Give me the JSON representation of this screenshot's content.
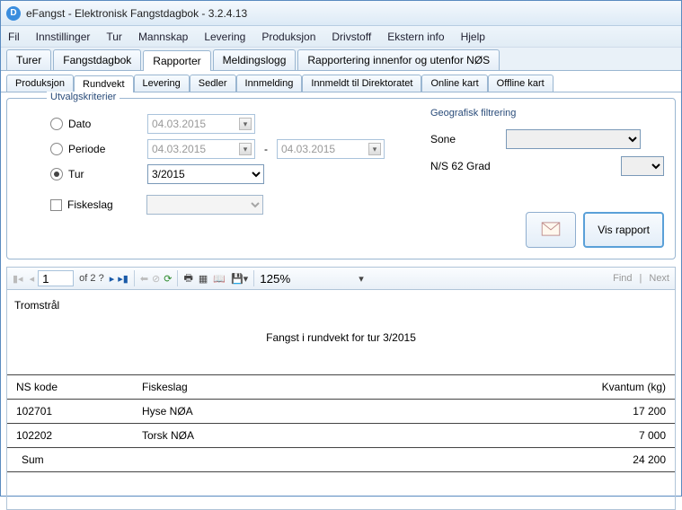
{
  "window": {
    "title": "eFangst - Elektronisk Fangstdagbok - 3.2.4.13"
  },
  "menu": [
    "Fil",
    "Innstillinger",
    "Tur",
    "Mannskap",
    "Levering",
    "Produksjon",
    "Drivstoff",
    "Ekstern info",
    "Hjelp"
  ],
  "maintabs": [
    "Turer",
    "Fangstdagbok",
    "Rapporter",
    "Meldingslogg",
    "Rapportering innenfor og utenfor NØS"
  ],
  "active_maintab": 2,
  "subtabs": [
    "Produksjon",
    "Rundvekt",
    "Levering",
    "Sedler",
    "Innmelding",
    "Innmeldt til Direktoratet",
    "Online kart",
    "Offline kart"
  ],
  "active_subtab": 1,
  "criteria": {
    "legend": "Utvalgskriterier",
    "dato_label": "Dato",
    "dato_value": "04.03.2015",
    "periode_label": "Periode",
    "periode_from": "04.03.2015",
    "periode_to": "04.03.2015",
    "tur_label": "Tur",
    "tur_value": "3/2015",
    "fiskeslag_label": "Fiskeslag",
    "geo_legend": "Geografisk filtrering",
    "sone_label": "Sone",
    "ns_label": "N/S 62 Grad",
    "btn_vis": "Vis rapport"
  },
  "viewer": {
    "page": "1",
    "of": "of  2 ?",
    "zoom": "125%",
    "find": "Find",
    "next": "Next"
  },
  "report": {
    "vessel": "Tromstrål",
    "title": "Fangst i rundvekt for tur  3/2015",
    "columns": [
      "NS kode",
      "Fiskeslag",
      "Kvantum (kg)"
    ],
    "rows": [
      {
        "ns": "102701",
        "slag": "Hyse NØA",
        "kg": "17 200"
      },
      {
        "ns": "102202",
        "slag": "Torsk NØA",
        "kg": "7 000"
      }
    ],
    "sum_label": "Sum",
    "sum_value": "24 200"
  }
}
